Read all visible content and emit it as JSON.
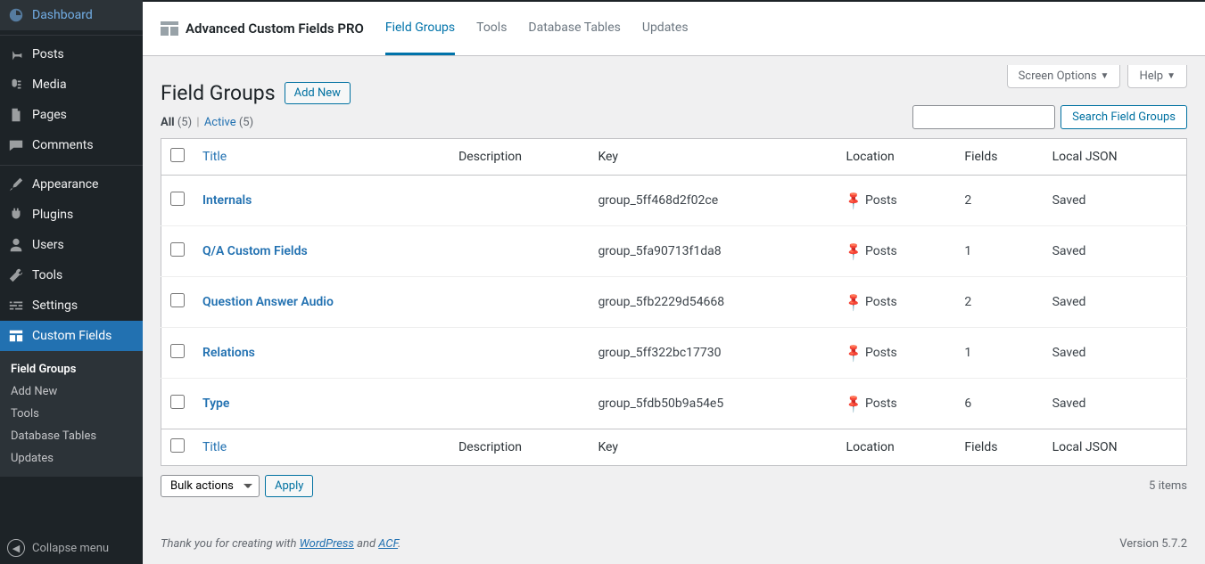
{
  "sidebar": {
    "items": [
      {
        "label": "Dashboard",
        "icon": "dashboard"
      },
      {
        "label": "Posts",
        "icon": "pin"
      },
      {
        "label": "Media",
        "icon": "media"
      },
      {
        "label": "Pages",
        "icon": "page"
      },
      {
        "label": "Comments",
        "icon": "comment"
      },
      {
        "label": "Appearance",
        "icon": "brush"
      },
      {
        "label": "Plugins",
        "icon": "plug"
      },
      {
        "label": "Users",
        "icon": "user"
      },
      {
        "label": "Tools",
        "icon": "wrench"
      },
      {
        "label": "Settings",
        "icon": "sliders"
      },
      {
        "label": "Custom Fields",
        "icon": "layout"
      }
    ],
    "submenu": [
      {
        "label": "Field Groups",
        "current": true
      },
      {
        "label": "Add New"
      },
      {
        "label": "Tools"
      },
      {
        "label": "Database Tables"
      },
      {
        "label": "Updates"
      }
    ],
    "collapse": "Collapse menu"
  },
  "topbar": {
    "brand": "Advanced Custom Fields PRO",
    "nav": [
      "Field Groups",
      "Tools",
      "Database Tables",
      "Updates"
    ],
    "active_index": 0
  },
  "screen_meta": {
    "screen_options": "Screen Options",
    "help": "Help"
  },
  "heading": {
    "title": "Field Groups",
    "add_new": "Add New"
  },
  "filters": {
    "all_label": "All",
    "all_count": "(5)",
    "active_label": "Active",
    "active_count": "(5)"
  },
  "search": {
    "button": "Search Field Groups"
  },
  "columns": {
    "title": "Title",
    "description": "Description",
    "key": "Key",
    "location": "Location",
    "fields": "Fields",
    "local_json": "Local JSON"
  },
  "rows": [
    {
      "title": "Internals",
      "description": "",
      "key": "group_5ff468d2f02ce",
      "location": "Posts",
      "fields": "2",
      "json": "Saved"
    },
    {
      "title": "Q/A Custom Fields",
      "description": "",
      "key": "group_5fa90713f1da8",
      "location": "Posts",
      "fields": "1",
      "json": "Saved"
    },
    {
      "title": "Question Answer Audio",
      "description": "",
      "key": "group_5fb2229d54668",
      "location": "Posts",
      "fields": "2",
      "json": "Saved"
    },
    {
      "title": "Relations",
      "description": "",
      "key": "group_5ff322bc17730",
      "location": "Posts",
      "fields": "1",
      "json": "Saved"
    },
    {
      "title": "Type",
      "description": "",
      "key": "group_5fdb50b9a54e5",
      "location": "Posts",
      "fields": "6",
      "json": "Saved"
    }
  ],
  "bulk": {
    "label": "Bulk actions",
    "apply": "Apply"
  },
  "item_count": "5 items",
  "footer": {
    "pre": "Thank you for creating with ",
    "wp": "WordPress",
    "mid": " and ",
    "acf": "ACF",
    "post": ".",
    "version": "Version 5.7.2"
  }
}
